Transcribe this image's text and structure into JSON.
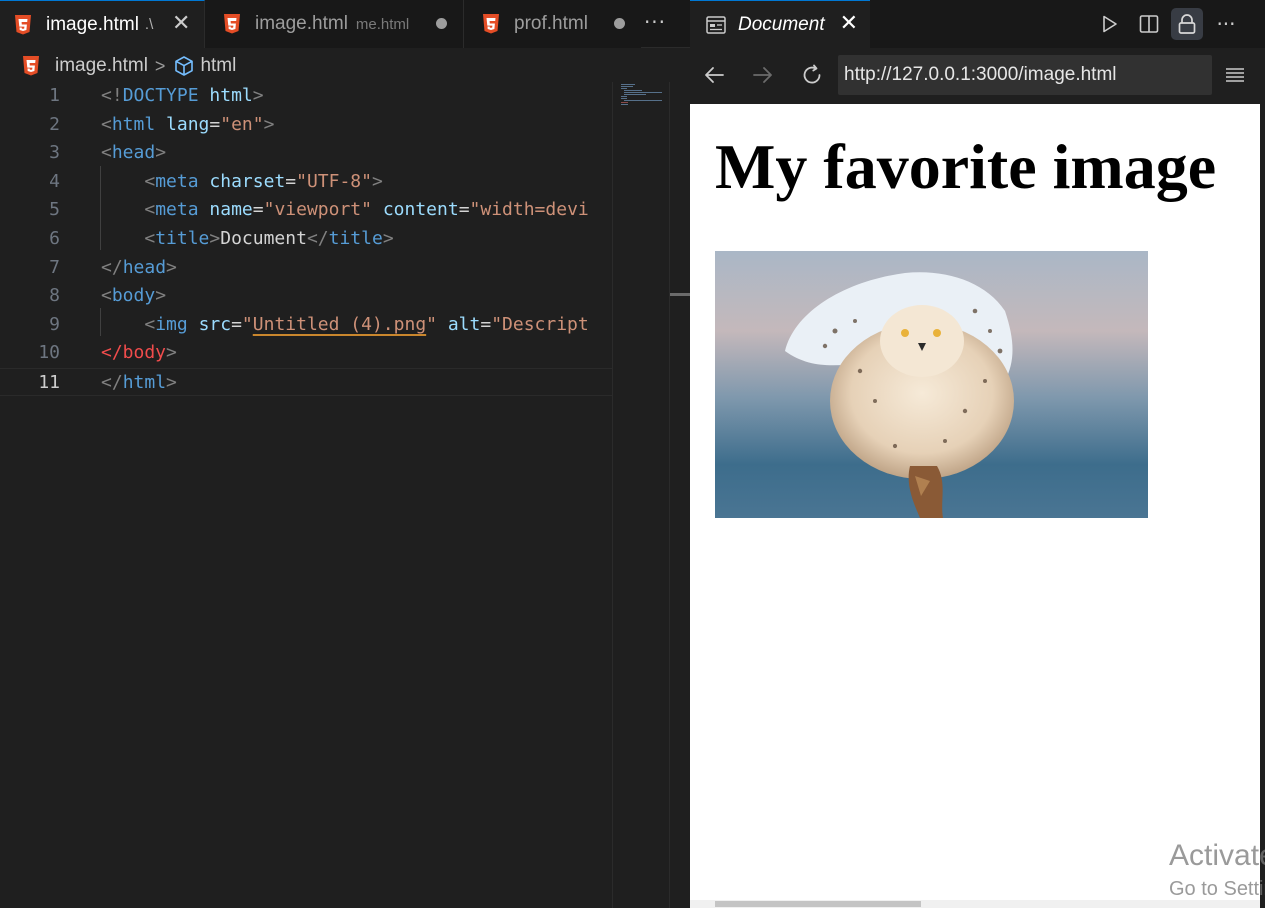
{
  "editor": {
    "tabs": [
      {
        "name": "image.html",
        "desc": ".\\",
        "state": "active",
        "close": "✕"
      },
      {
        "name": "image.html",
        "desc": "me.html",
        "state": "modified"
      },
      {
        "name": "prof.html",
        "desc": "",
        "state": "modified"
      }
    ],
    "more_icon": "···",
    "breadcrumb": {
      "file": "image.html",
      "separator": ">",
      "symbol": "html"
    },
    "lines": [
      {
        "n": "1",
        "tokens": [
          [
            "p",
            "<!"
          ],
          [
            "t",
            "DOCTYPE"
          ],
          [
            "x",
            " "
          ],
          [
            "a",
            "html"
          ],
          [
            "p",
            ">"
          ]
        ]
      },
      {
        "n": "2",
        "tokens": [
          [
            "p",
            "<"
          ],
          [
            "t",
            "html"
          ],
          [
            "x",
            " "
          ],
          [
            "a",
            "lang"
          ],
          [
            "x",
            "="
          ],
          [
            "s",
            "\"en\""
          ],
          [
            "p",
            ">"
          ]
        ]
      },
      {
        "n": "3",
        "tokens": [
          [
            "p",
            "<"
          ],
          [
            "t",
            "head"
          ],
          [
            "p",
            ">"
          ]
        ]
      },
      {
        "n": "4",
        "tokens": [
          [
            "x",
            "    "
          ],
          [
            "p",
            "<"
          ],
          [
            "t",
            "meta"
          ],
          [
            "x",
            " "
          ],
          [
            "a",
            "charset"
          ],
          [
            "x",
            "="
          ],
          [
            "s",
            "\"UTF-8\""
          ],
          [
            "p",
            ">"
          ]
        ]
      },
      {
        "n": "5",
        "tokens": [
          [
            "x",
            "    "
          ],
          [
            "p",
            "<"
          ],
          [
            "t",
            "meta"
          ],
          [
            "x",
            " "
          ],
          [
            "a",
            "name"
          ],
          [
            "x",
            "="
          ],
          [
            "s",
            "\"viewport\""
          ],
          [
            "x",
            " "
          ],
          [
            "a",
            "content"
          ],
          [
            "x",
            "="
          ],
          [
            "s",
            "\"width=devi"
          ]
        ]
      },
      {
        "n": "6",
        "tokens": [
          [
            "x",
            "    "
          ],
          [
            "p",
            "<"
          ],
          [
            "t",
            "title"
          ],
          [
            "p",
            ">"
          ],
          [
            "x",
            "Document"
          ],
          [
            "p",
            "</"
          ],
          [
            "t",
            "title"
          ],
          [
            "p",
            ">"
          ]
        ]
      },
      {
        "n": "7",
        "tokens": [
          [
            "p",
            "</"
          ],
          [
            "t",
            "head"
          ],
          [
            "p",
            ">"
          ]
        ]
      },
      {
        "n": "8",
        "tokens": [
          [
            "p",
            "<"
          ],
          [
            "t",
            "body"
          ],
          [
            "p",
            ">"
          ]
        ]
      },
      {
        "n": "9",
        "tokens": [
          [
            "x",
            "    "
          ],
          [
            "p",
            "<"
          ],
          [
            "t",
            "img"
          ],
          [
            "x",
            " "
          ],
          [
            "a",
            "src"
          ],
          [
            "x",
            "="
          ],
          [
            "s",
            "\""
          ],
          [
            "su",
            "Untitled (4).png"
          ],
          [
            "s",
            "\""
          ],
          [
            "x",
            " "
          ],
          [
            "a",
            "alt"
          ],
          [
            "x",
            "="
          ],
          [
            "s",
            "\"Descript"
          ]
        ]
      },
      {
        "n": "10",
        "tokens": [
          [
            "e",
            "</body"
          ],
          [
            "p",
            ">"
          ]
        ]
      },
      {
        "n": "11",
        "tokens": [
          [
            "p",
            "</"
          ],
          [
            "t",
            "html"
          ],
          [
            "p",
            ">"
          ]
        ],
        "current": true
      }
    ]
  },
  "preview": {
    "tab_label": "Document",
    "tab_close": "✕",
    "more_icon": "···",
    "url": "http://127.0.0.1:3000/image.html",
    "page": {
      "heading": "My favorite image",
      "image_alt": "Snowy owl with spread wings landing on a post"
    }
  },
  "watermark": {
    "line1": "Activate",
    "line2": "Go to Settings"
  },
  "colors": {
    "accent": "#0078d4",
    "html5": "#e44d26",
    "editor_bg": "#1f1f1f"
  },
  "icons": [
    "html5-icon",
    "cube-icon",
    "close-icon",
    "more-icon",
    "document-icon",
    "play-icon",
    "split-icon",
    "lock-icon",
    "back-icon",
    "forward-icon",
    "reload-icon",
    "menu-icon"
  ]
}
